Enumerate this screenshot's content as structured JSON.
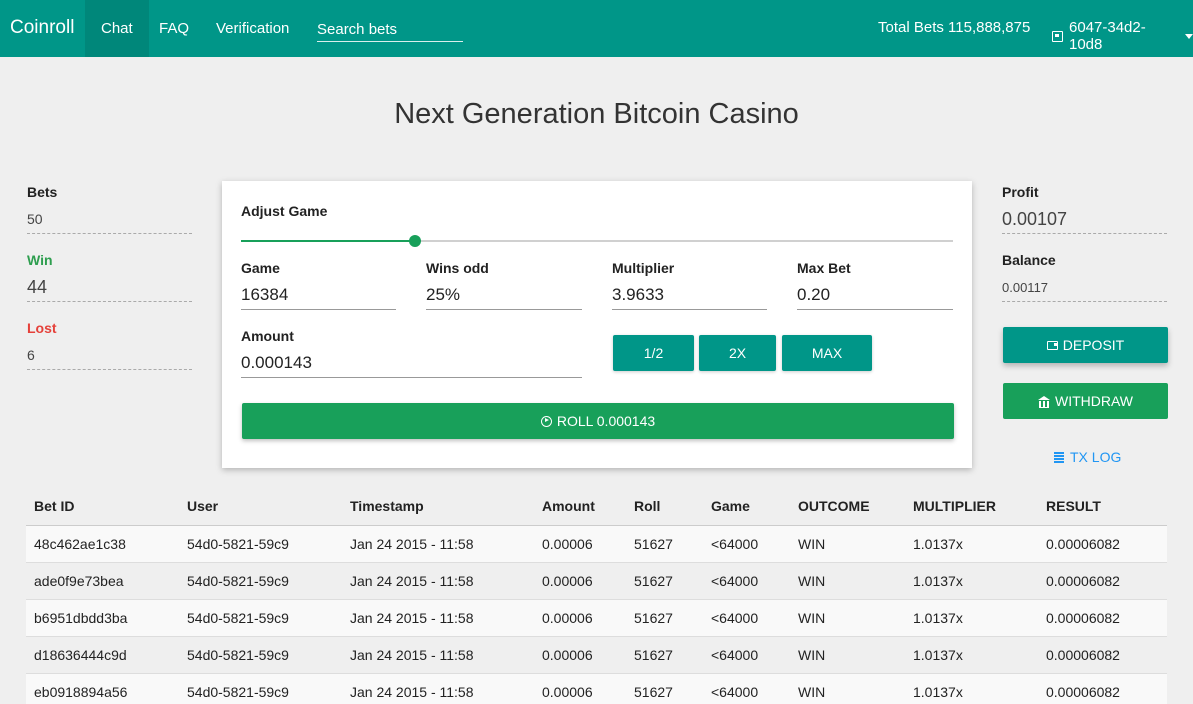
{
  "nav": {
    "brand": "Coinroll",
    "items": [
      {
        "label": "Chat",
        "active": true
      },
      {
        "label": "FAQ",
        "active": false
      },
      {
        "label": "Verification",
        "active": false
      }
    ],
    "search_placeholder": "Search bets",
    "total_bets": "Total Bets 115,888,875",
    "account_id": "6047-34d2-10d8"
  },
  "page_title": "Next Generation Bitcoin Casino",
  "left_stats": {
    "bets_label": "Bets",
    "bets_value": "50",
    "win_label": "Win",
    "win_value": "44",
    "lost_label": "Lost",
    "lost_value": "6"
  },
  "right_stats": {
    "profit_label": "Profit",
    "profit_value": "0.00107",
    "balance_label": "Balance",
    "balance_value": "0.00117",
    "deposit_label": "DEPOSIT",
    "withdraw_label": "WITHDRAW",
    "txlog_label": "TX LOG"
  },
  "game": {
    "adjust_label": "Adjust Game",
    "slider_fraction": 0.245,
    "game_label": "Game",
    "game_value": "16384",
    "wins_odd_label": "Wins odd",
    "wins_odd_value": "25%",
    "multiplier_label": "Multiplier",
    "multiplier_value": "3.9633",
    "max_bet_label": "Max Bet",
    "max_bet_value": "0.20",
    "amount_label": "Amount",
    "amount_value": "0.000143",
    "half_label": "1/2",
    "double_label": "2X",
    "max_label": "MAX",
    "roll_label": "ROLL 0.000143"
  },
  "table": {
    "headers": [
      "Bet ID",
      "User",
      "Timestamp",
      "Amount",
      "Roll",
      "Game",
      "OUTCOME",
      "MULTIPLIER",
      "RESULT"
    ],
    "rows": [
      [
        "48c462ae1c38",
        "54d0-5821-59c9",
        "Jan 24 2015 - 11:58",
        "0.00006",
        "51627",
        "<64000",
        "WIN",
        "1.0137x",
        "0.00006082"
      ],
      [
        "ade0f9e73bea",
        "54d0-5821-59c9",
        "Jan 24 2015 - 11:58",
        "0.00006",
        "51627",
        "<64000",
        "WIN",
        "1.0137x",
        "0.00006082"
      ],
      [
        "b6951dbdd3ba",
        "54d0-5821-59c9",
        "Jan 24 2015 - 11:58",
        "0.00006",
        "51627",
        "<64000",
        "WIN",
        "1.0137x",
        "0.00006082"
      ],
      [
        "d18636444c9d",
        "54d0-5821-59c9",
        "Jan 24 2015 - 11:58",
        "0.00006",
        "51627",
        "<64000",
        "WIN",
        "1.0137x",
        "0.00006082"
      ],
      [
        "eb0918894a56",
        "54d0-5821-59c9",
        "Jan 24 2015 - 11:58",
        "0.00006",
        "51627",
        "<64000",
        "WIN",
        "1.0137x",
        "0.00006082"
      ]
    ]
  },
  "colors": {
    "nav": "#009688",
    "accent_green": "#18a05a",
    "win": "#2e9e4f",
    "lost": "#e5413a",
    "profit": "#f05a28",
    "link": "#2196f3"
  }
}
